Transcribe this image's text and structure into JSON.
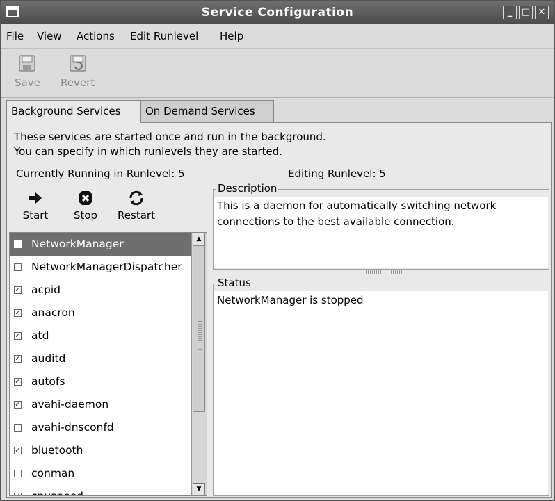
{
  "window": {
    "title": "Service Configuration"
  },
  "menu": [
    "File",
    "View",
    "Actions",
    "Edit Runlevel",
    "Help"
  ],
  "toolbar": {
    "save": "Save",
    "revert": "Revert"
  },
  "tabs": [
    "Background Services",
    "On Demand Services"
  ],
  "intro": {
    "line1": "These services are started once and run in the background.",
    "line2": "You can specify in which runlevels they are started."
  },
  "runlevel": {
    "running": "Currently Running in Runlevel: 5",
    "editing": "Editing Runlevel: 5"
  },
  "actions": {
    "start": "Start",
    "stop": "Stop",
    "restart": "Restart"
  },
  "services": [
    {
      "name": "NetworkManager",
      "checked": false,
      "selected": true
    },
    {
      "name": "NetworkManagerDispatcher",
      "checked": false
    },
    {
      "name": "acpid",
      "checked": true
    },
    {
      "name": "anacron",
      "checked": true
    },
    {
      "name": "atd",
      "checked": true
    },
    {
      "name": "auditd",
      "checked": true
    },
    {
      "name": "autofs",
      "checked": true
    },
    {
      "name": "avahi-daemon",
      "checked": true
    },
    {
      "name": "avahi-dnsconfd",
      "checked": false
    },
    {
      "name": "bluetooth",
      "checked": true
    },
    {
      "name": "conman",
      "checked": false
    },
    {
      "name": "cpuspeed",
      "checked": true
    }
  ],
  "description": {
    "label": "Description",
    "text": "This is a daemon for automatically switching network connections to the best available connection."
  },
  "status": {
    "label": "Status",
    "text": "NetworkManager is stopped"
  }
}
